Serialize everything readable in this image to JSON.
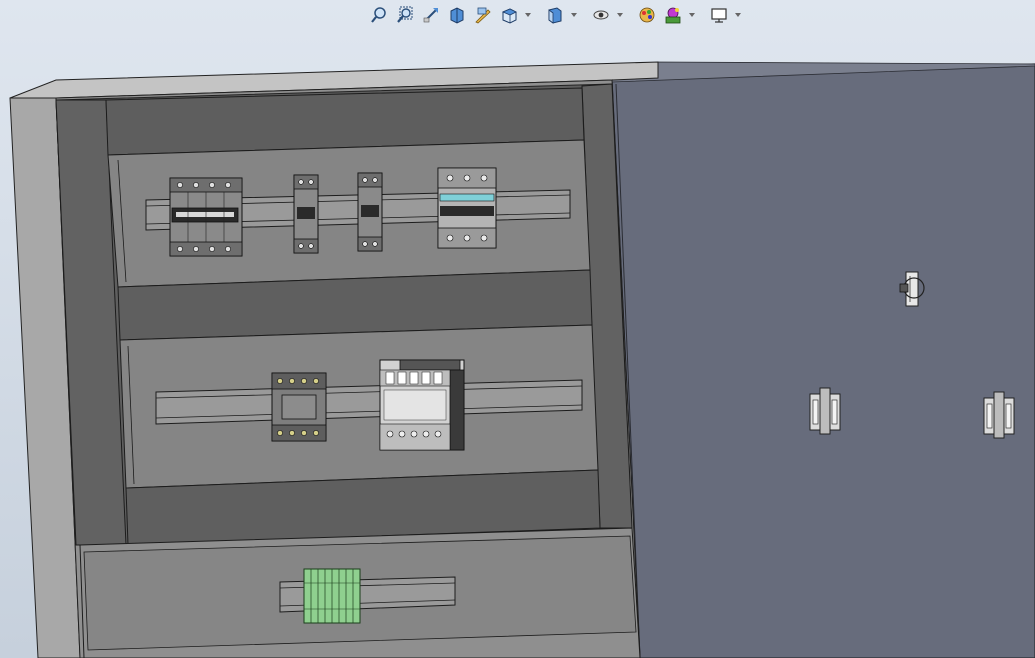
{
  "toolbar": {
    "items": [
      {
        "icon": "zoom-to-fit-icon",
        "dropdown": false
      },
      {
        "icon": "zoom-to-area-icon",
        "dropdown": false
      },
      {
        "icon": "previous-view-icon",
        "dropdown": false
      },
      {
        "icon": "section-view-icon",
        "dropdown": false
      },
      {
        "icon": "dynamic-annotation-icon",
        "dropdown": false
      },
      {
        "icon": "view-orientation-icon",
        "dropdown": true
      },
      {
        "icon": "display-style-icon",
        "dropdown": true
      },
      {
        "icon": "hide-show-items-icon",
        "dropdown": true
      },
      {
        "icon": "edit-appearance-icon",
        "dropdown": false
      },
      {
        "icon": "apply-scene-icon",
        "dropdown": true
      },
      {
        "icon": "view-settings-icon",
        "dropdown": true
      }
    ]
  },
  "model": {
    "door_handle_count": 1,
    "door_hinge_count": 2,
    "top_rail_devices": [
      "4-pole-breaker",
      "1-pole-breaker",
      "1-pole-breaker",
      "rccb"
    ],
    "middle_rail_devices": [
      "contactor",
      "power-supply"
    ],
    "bottom_rail_devices": [
      "terminal-block-strip"
    ],
    "colors": {
      "background_top": "#dfe6ef",
      "background_bottom": "#c6d0dc",
      "cabinet": "#9a9a9a",
      "door": "#676c7c",
      "terminal_green": "#8fd08f",
      "rccb_accent": "#7fd0d8"
    }
  }
}
